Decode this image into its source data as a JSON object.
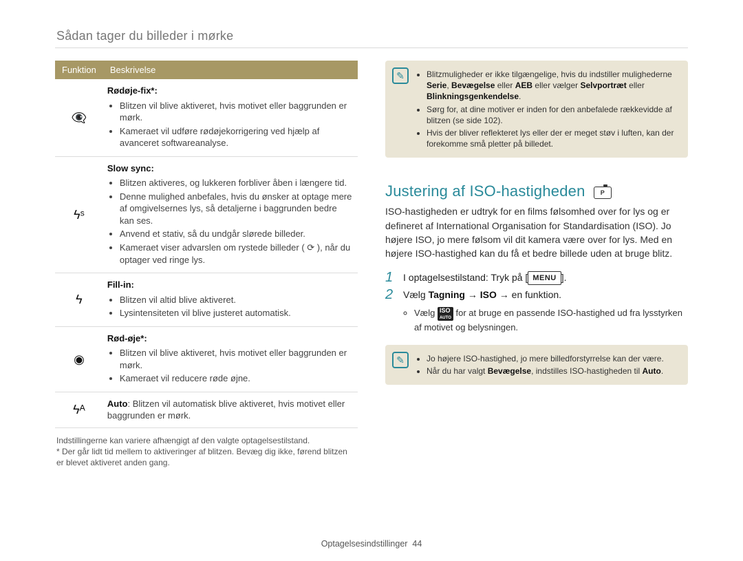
{
  "header": {
    "breadcrumb": "Sådan tager du billeder i mørke"
  },
  "table": {
    "headers": [
      "Funktion",
      "Beskrivelse"
    ],
    "rows": [
      {
        "icon": "👁️‍🗨️",
        "heading": "Rødøje-fix*:",
        "items": [
          "Blitzen vil blive aktiveret, hvis motivet eller baggrunden er mørk.",
          "Kameraet vil udføre rødøjekorrigering ved hjælp af avanceret softwareanalyse."
        ]
      },
      {
        "icon": "ϟˢ",
        "heading": "Slow sync:",
        "items": [
          "Blitzen aktiveres, og lukkeren forbliver åben i længere tid.",
          "Denne mulighed anbefales, hvis du ønsker at optage mere af omgivelsernes lys, så detaljerne i baggrunden bedre kan ses.",
          "Anvend et stativ, så du undgår slørede billeder.",
          "Kameraet viser advarslen om rystede billeder ( ⟳ ), når du optager ved ringe lys."
        ]
      },
      {
        "icon": "ϟ",
        "heading": "Fill-in:",
        "items": [
          "Blitzen vil altid blive aktiveret.",
          "Lysintensiteten vil blive justeret automatisk."
        ]
      },
      {
        "icon": "◉",
        "heading": "Rød-øje*:",
        "items": [
          "Blitzen vil blive aktiveret, hvis motivet eller baggrunden er mørk.",
          "Kameraet vil reducere røde øjne."
        ]
      },
      {
        "icon": "ϟᴬ",
        "plain_before": "Auto",
        "plain_after": ": Blitzen vil automatisk blive aktiveret, hvis motivet eller baggrunden er mørk."
      }
    ]
  },
  "footnotes": {
    "line1": "Indstillingerne kan variere afhængigt af den valgte optagelsestilstand.",
    "line2": "* Der går lidt tid mellem to aktiveringer af blitzen. Bevæg dig ikke, førend blitzen er blevet aktiveret anden gang."
  },
  "info_top": {
    "items_html": [
      "Blitzmuligheder er ikke tilgængelige, hvis du indstiller mulighederne <b>Serie</b>, <b>Bevægelse</b> eller <b>AEB</b> eller vælger <b>Selvportræt</b> eller <b>Blinkningsgenkendelse</b>.",
      "Sørg for, at dine motiver er inden for den anbefalede rækkevidde af blitzen (se side 102).",
      "Hvis der bliver reflekteret lys eller der er meget støv i luften, kan der forekomme små pletter på billedet."
    ]
  },
  "section": {
    "title": "Justering af ISO-hastigheden",
    "paragraph": "ISO-hastigheden er udtryk for en films følsomhed over for lys og er defineret af International Organisation for Standardisation (ISO). Jo højere ISO, jo mere følsom vil dit kamera være over for lys. Med en højere ISO-hastighed kan du få et bedre billede uden at bruge blitz."
  },
  "steps": {
    "s1_before": "I optagelsestilstand: Tryk på [",
    "s1_menu": "MENU",
    "s1_after": "].",
    "s2_before": "Vælg ",
    "s2_b1": "Tagning",
    "s2_arrow": " → ",
    "s2_b2": "ISO",
    "s2_after": " → en funktion.",
    "sub_before": "Vælg ",
    "sub_chip_top": "ISO",
    "sub_chip_bot": "AUTO",
    "sub_after": " for at bruge en passende ISO-hastighed ud fra lysstyrken af motivet og belysningen."
  },
  "info_bottom": {
    "items_html": [
      "Jo højere ISO-hastighed, jo mere billedforstyrrelse kan der være.",
      "Når du har valgt <b>Bevægelse</b>, indstilles ISO-hastigheden til <b>Auto</b>."
    ]
  },
  "footer": {
    "section_name": "Optagelsesindstillinger",
    "page": "44"
  }
}
